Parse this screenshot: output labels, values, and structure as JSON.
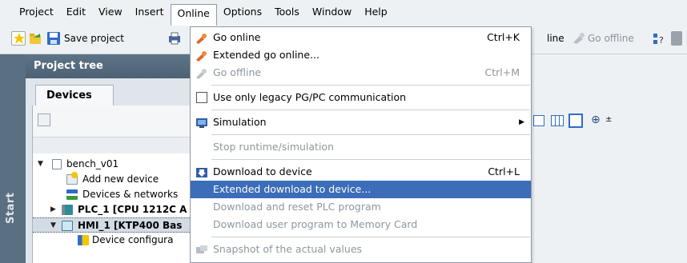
{
  "menubar": {
    "items": [
      {
        "label": "Project"
      },
      {
        "label": "Edit"
      },
      {
        "label": "View"
      },
      {
        "label": "Insert"
      },
      {
        "label": "Online"
      },
      {
        "label": "Options"
      },
      {
        "label": "Tools"
      },
      {
        "label": "Window"
      },
      {
        "label": "Help"
      }
    ]
  },
  "toolbar": {
    "save_label": "Save project",
    "go_online_partial": "line",
    "go_offline_label": "Go offline"
  },
  "project_tree": {
    "title": "Project tree",
    "tab_label": "Devices",
    "start_label": "Start",
    "items": [
      {
        "label": "bench_v01"
      },
      {
        "label": "Add new device"
      },
      {
        "label": "Devices & networks"
      },
      {
        "label": "PLC_1 [CPU 1212C A"
      },
      {
        "label": "HMI_1 [KTP400 Bas"
      },
      {
        "label": "Device configura"
      }
    ]
  },
  "online_menu": {
    "items": [
      {
        "label": "Go online",
        "shortcut": "Ctrl+K"
      },
      {
        "label": "Extended go online...",
        "shortcut": ""
      },
      {
        "label": "Go offline",
        "shortcut": "Ctrl+M"
      },
      {
        "label": "Use only legacy PG/PC communication"
      },
      {
        "label": "Simulation"
      },
      {
        "label": "Stop runtime/simulation"
      },
      {
        "label": "Download to device",
        "shortcut": "Ctrl+L"
      },
      {
        "label": "Extended download to device..."
      },
      {
        "label": "Download and reset PLC program"
      },
      {
        "label": "Download user program to Memory Card"
      },
      {
        "label": "Snapshot of the actual values"
      }
    ]
  },
  "colors": {
    "highlight": "#3c6db8",
    "tree_header": "#566b7e",
    "disabled_text": "#8e969e"
  }
}
